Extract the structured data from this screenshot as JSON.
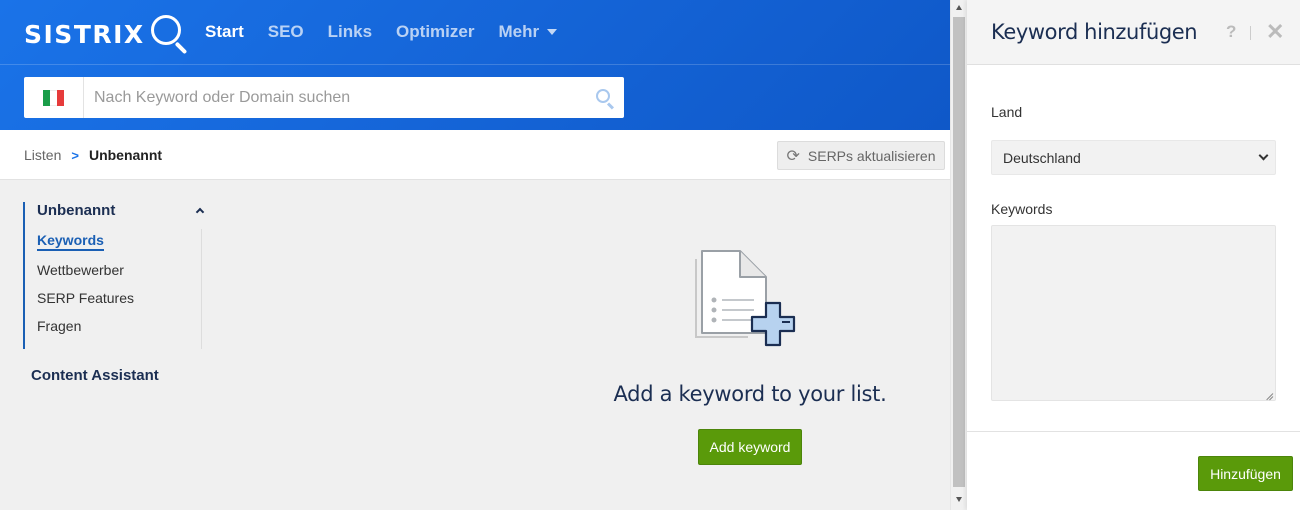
{
  "header": {
    "logo_text": "SISTRIX",
    "nav": [
      {
        "label": "Start"
      },
      {
        "label": "SEO"
      },
      {
        "label": "Links"
      },
      {
        "label": "Optimizer"
      },
      {
        "label": "Mehr"
      }
    ],
    "search": {
      "placeholder": "Nach Keyword oder Domain suchen",
      "country_flag": "italy-flag",
      "flag_colors": [
        "#1a9d49",
        "#ffffff",
        "#e63b3b"
      ]
    }
  },
  "breadcrumb": {
    "parent": "Listen",
    "current": "Unbenannt"
  },
  "toolbar": {
    "refresh_label": "SERPs aktualisieren"
  },
  "sidebar": {
    "group_title": "Unbenannt",
    "items": [
      {
        "label": "Keywords",
        "active": true
      },
      {
        "label": "Wettbewerber"
      },
      {
        "label": "SERP Features"
      },
      {
        "label": "Fragen"
      }
    ],
    "extra": "Content Assistant"
  },
  "empty_state": {
    "message": "Add a keyword to your list.",
    "button_label": "Add keyword"
  },
  "panel": {
    "title": "Keyword hinzufügen",
    "help": "?",
    "close": "✕",
    "country_label": "Land",
    "country_value": "Deutschland",
    "keywords_label": "Keywords",
    "keywords_value": "",
    "submit_label": "Hinzufügen"
  },
  "colors": {
    "brand_blue": "#1a73e8",
    "accent_green": "#5a9a0a",
    "navy_text": "#1b2e52"
  }
}
